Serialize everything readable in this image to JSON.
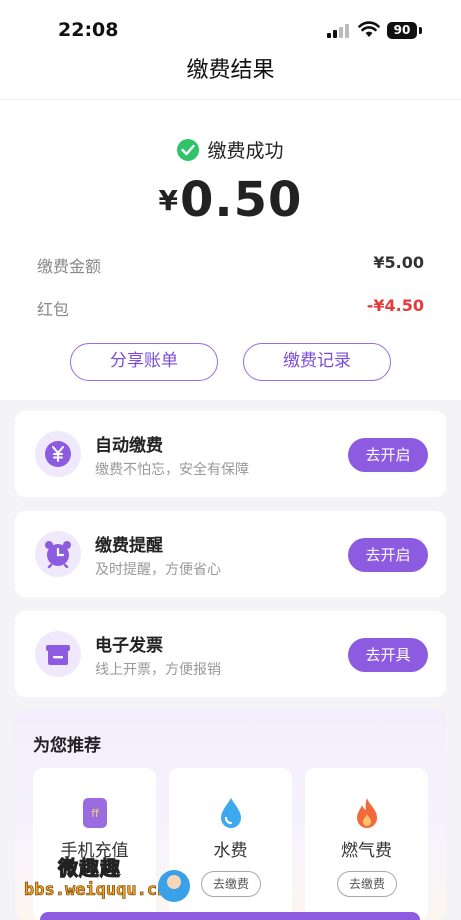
{
  "status_bar": {
    "time": "22:08",
    "battery": "90"
  },
  "header": {
    "title": "缴费结果"
  },
  "result": {
    "status_text": "缴费成功",
    "currency": "¥",
    "amount": "0.50",
    "rows": [
      {
        "label": "缴费金额",
        "value": "¥5.00"
      },
      {
        "label": "红包",
        "value": "-¥4.50"
      }
    ],
    "share_button": "分享账单",
    "records_button": "缴费记录"
  },
  "services": [
    {
      "title": "自动缴费",
      "subtitle": "缴费不怕忘，安全有保障",
      "action": "去开启",
      "icon": "yen-icon"
    },
    {
      "title": "缴费提醒",
      "subtitle": "及时提醒，方便省心",
      "action": "去开启",
      "icon": "alarm-clock-icon"
    },
    {
      "title": "电子发票",
      "subtitle": "线上开票，方便报销",
      "action": "去开具",
      "icon": "invoice-icon"
    }
  ],
  "recommend": {
    "title": "为您推荐",
    "items": [
      {
        "name": "手机充值",
        "action": "",
        "icon": "phone-topup-icon"
      },
      {
        "name": "水费",
        "action": "去缴费",
        "icon": "water-drop-icon"
      },
      {
        "name": "燃气费",
        "action": "去缴费",
        "icon": "flame-icon"
      }
    ]
  },
  "watermark": {
    "text": "微趣趣",
    "url": "bbs.weiququ.cn"
  },
  "colors": {
    "accent": "#8c5be0",
    "success": "#2fc36a",
    "discount": "#e8393a"
  }
}
